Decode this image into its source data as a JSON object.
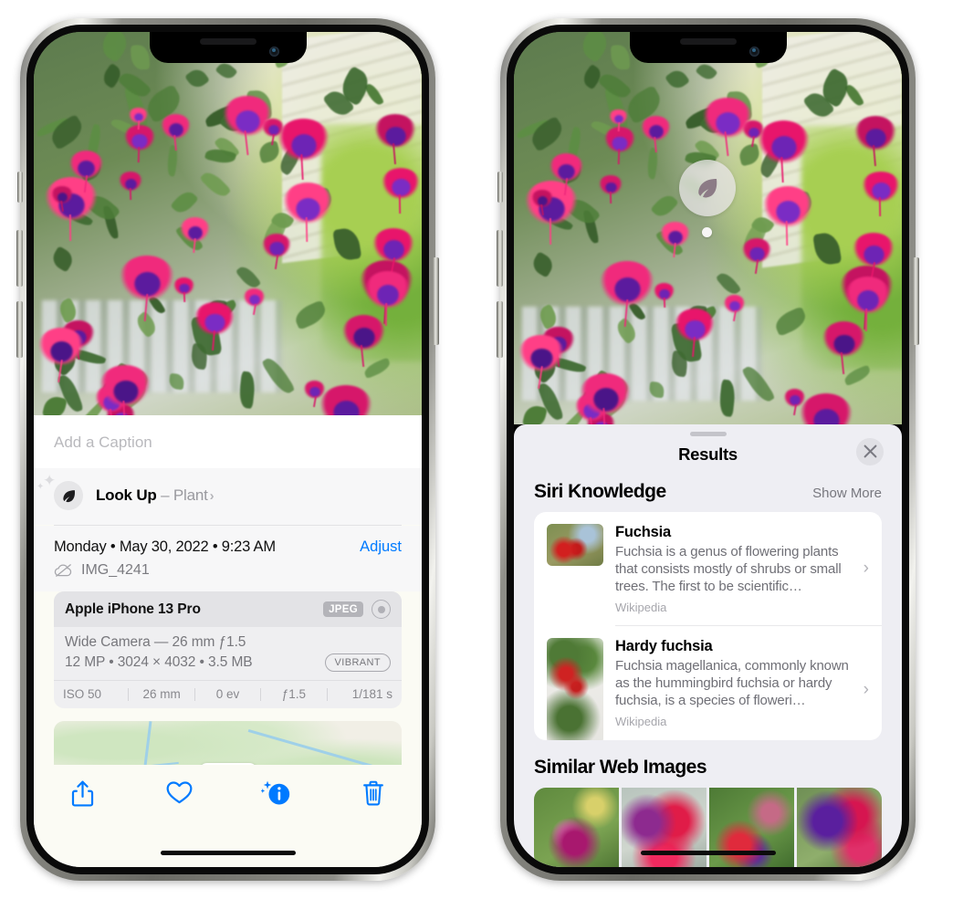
{
  "left_phone": {
    "name": "photos-detail-screen",
    "caption": {
      "placeholder": "Add a Caption"
    },
    "lookup": {
      "title": "Look Up",
      "dash": " – ",
      "subject": "Plant",
      "icon": "leaf-icon",
      "chevron": "›"
    },
    "meta": {
      "date": "Monday • May 30, 2022 • 9:23 AM",
      "adjust_label": "Adjust",
      "filename": "IMG_4241",
      "cloud_icon": "cloud-slash-icon"
    },
    "exif": {
      "device": "Apple iPhone 13 Pro",
      "format_badge": "JPEG",
      "aperture_icon": "aperture-icon",
      "lens": "Wide Camera — 26 mm ƒ1.5",
      "size_line": "12 MP • 3024 × 4032 • 3.5 MB",
      "style_badge": "VIBRANT",
      "stats": [
        "ISO 50",
        "26 mm",
        "0 ev",
        "ƒ1.5",
        "1/181 s"
      ]
    },
    "toolbar": [
      {
        "name": "share-button",
        "icon": "share-icon"
      },
      {
        "name": "favorite-button",
        "icon": "heart-icon"
      },
      {
        "name": "info-button",
        "icon": "info-sparkle-icon"
      },
      {
        "name": "delete-button",
        "icon": "trash-icon"
      }
    ]
  },
  "right_phone": {
    "name": "visual-look-up-results-screen",
    "badge": {
      "icon": "leaf-icon"
    },
    "sheet": {
      "title": "Results",
      "close_icon": "close-icon",
      "siri": {
        "section_title": "Siri Knowledge",
        "show_more": "Show More",
        "items": [
          {
            "title": "Fuchsia",
            "description": "Fuchsia is a genus of flowering plants that consists mostly of shrubs or small trees. The first to be scientific…",
            "source": "Wikipedia"
          },
          {
            "title": "Hardy fuchsia",
            "description": "Fuchsia magellanica, commonly known as the hummingbird fuchsia or hardy fuchsia, is a species of floweri…",
            "source": "Wikipedia"
          }
        ]
      },
      "similar": {
        "section_title": "Similar Web Images",
        "count": 4
      }
    }
  },
  "colors": {
    "accent": "#007aff",
    "sheet_bg": "#eeeef3",
    "card_bg": "#ffffff",
    "info_bg": "#fbfbf4"
  }
}
